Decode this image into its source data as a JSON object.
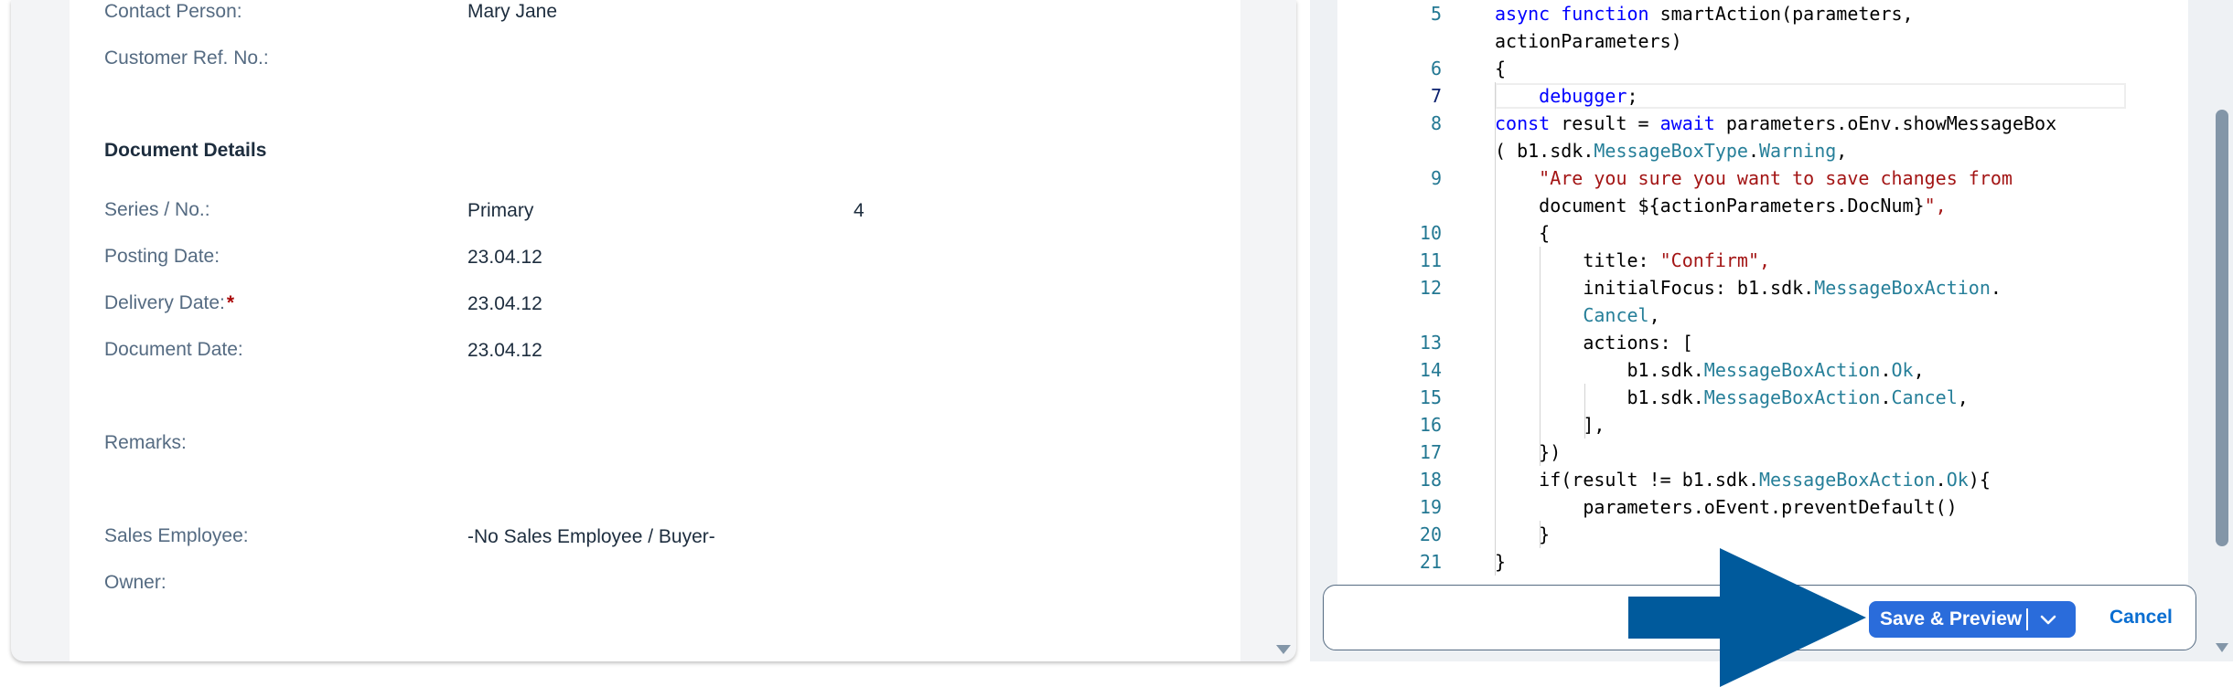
{
  "form": {
    "contact_person_label": "Contact Person:",
    "contact_person_value": "Mary Jane",
    "customer_ref_label": "Customer Ref. No.:",
    "document_details_title": "Document Details",
    "series_label": "Series / No.:",
    "series_value": "Primary",
    "series_number": "4",
    "posting_date_label": "Posting Date:",
    "posting_date_value": "23.04.12",
    "delivery_date_label": "Delivery Date:",
    "delivery_date_required": "*",
    "delivery_date_value": "23.04.12",
    "document_date_label": "Document Date:",
    "document_date_value": "23.04.12",
    "remarks_label": "Remarks:",
    "sales_employee_label": "Sales Employee:",
    "sales_employee_value": "-No Sales Employee / Buyer-",
    "owner_label": "Owner:"
  },
  "editor": {
    "active_line": "7",
    "lines": [
      {
        "num": "5",
        "text": "async function smartAction(parameters,"
      },
      {
        "num": "",
        "text": "actionParameters)"
      },
      {
        "num": "6",
        "text": "{"
      },
      {
        "num": "7",
        "text": "    debugger;"
      },
      {
        "num": "8",
        "text": "const result = await parameters.oEnv.showMessageBox"
      },
      {
        "num": "",
        "text": "( b1.sdk.MessageBoxType.Warning,"
      },
      {
        "num": "9",
        "text": "    \"Are you sure you want to save changes from"
      },
      {
        "num": "",
        "text": "    document ${actionParameters.DocNum}\","
      },
      {
        "num": "10",
        "text": "    {"
      },
      {
        "num": "11",
        "text": "        title: \"Confirm\","
      },
      {
        "num": "12",
        "text": "        initialFocus: b1.sdk.MessageBoxAction."
      },
      {
        "num": "",
        "text": "        Cancel,"
      },
      {
        "num": "13",
        "text": "        actions: ["
      },
      {
        "num": "14",
        "text": "            b1.sdk.MessageBoxAction.Ok,"
      },
      {
        "num": "15",
        "text": "            b1.sdk.MessageBoxAction.Cancel,"
      },
      {
        "num": "16",
        "text": "        ],"
      },
      {
        "num": "17",
        "text": "    })"
      },
      {
        "num": "18",
        "text": "    if(result != b1.sdk.MessageBoxAction.Ok){"
      },
      {
        "num": "19",
        "text": "        parameters.oEvent.preventDefault()"
      },
      {
        "num": "20",
        "text": "    }"
      },
      {
        "num": "21",
        "text": "}"
      }
    ]
  },
  "toolbar": {
    "save_label": "Save & Preview",
    "cancel_label": "Cancel"
  },
  "colors": {
    "primary_button": "#2a6cdb",
    "link": "#0a6ed1",
    "pointer_arrow": "#005a9c",
    "required": "#aa0808"
  },
  "icons": {
    "dropdown": "chevron-down-icon",
    "pointer": "arrow-right-icon",
    "scroll": "scroll-down-icon"
  }
}
